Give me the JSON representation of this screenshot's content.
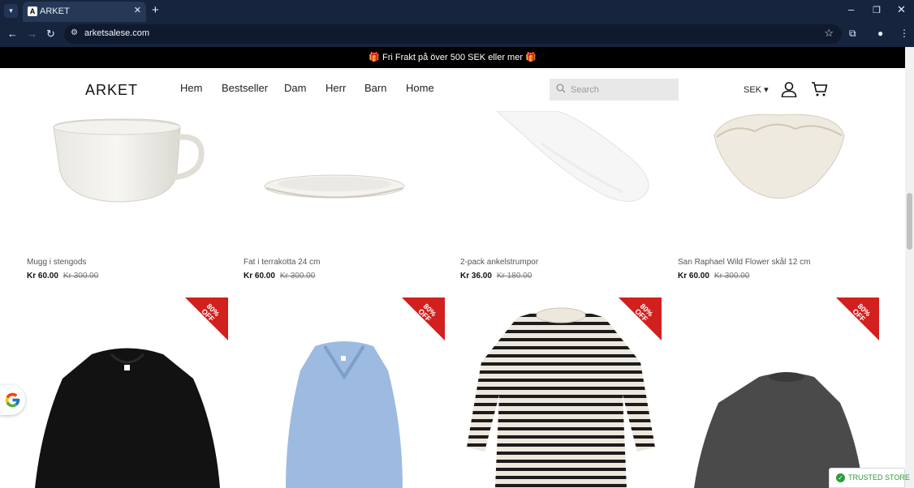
{
  "browser": {
    "tab_title": "ARKET",
    "tab_favicon": "A",
    "url": "arketsalese.com"
  },
  "announcement": "🎁 Fri Frakt på över 500 SEK eller mer 🎁",
  "header": {
    "logo": "ARKET",
    "nav": [
      "Hem",
      "Bestseller",
      "Dam",
      "Herr",
      "Barn",
      "Home"
    ],
    "search_placeholder": "Search",
    "currency": "SEK"
  },
  "products": [
    {
      "name": "Mugg i stengods",
      "price": "Kr 60.00",
      "old_price": "Kr 300.00"
    },
    {
      "name": "Fat i terrakotta 24 cm",
      "price": "Kr 60.00",
      "old_price": "Kr 300.00"
    },
    {
      "name": "2-pack ankelstrumpor",
      "price": "Kr 36.00",
      "old_price": "Kr 180.00"
    },
    {
      "name": "San Raphael Wild Flower skål 12 cm",
      "price": "Kr 60.00",
      "old_price": "Kr 300.00"
    }
  ],
  "badges": [
    "80% OFF",
    "80% OFF",
    "80% OFF",
    "80% OFF"
  ],
  "trusted_store": "TRUSTED STORE",
  "colors": {
    "ribbon": "#d1201e",
    "announcement_bg": "#000000",
    "trusted_green": "#2a9d3a"
  }
}
